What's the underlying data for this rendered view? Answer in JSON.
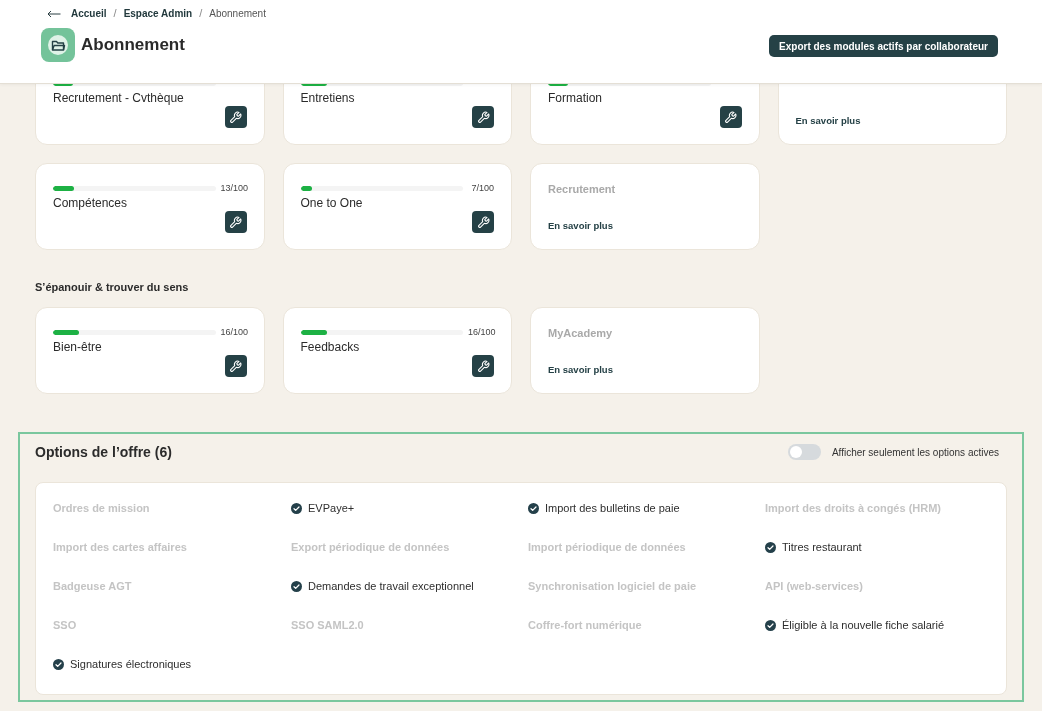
{
  "breadcrumb": {
    "separator": "/",
    "items": [
      {
        "label": "Accueil",
        "current": false
      },
      {
        "label": "Espace Admin",
        "current": false
      },
      {
        "label": "Abonnement",
        "current": true
      }
    ]
  },
  "page": {
    "title": "Abonnement",
    "export_button": "Export des modules actifs par collaborateur"
  },
  "sections": [
    {
      "modules": [
        {
          "kind": "subscribed",
          "name": "Recrutement - Cvthèque",
          "level": 0.12
        },
        {
          "kind": "subscribed",
          "name": "Entretiens",
          "level": 0.16
        },
        {
          "kind": "subscribed",
          "name": "Formation",
          "level": 0.12
        },
        {
          "kind": "unsubscribed",
          "link": "En savoir plus"
        },
        {
          "kind": "subscribed",
          "name": "Compétences",
          "level": 0.13,
          "count": "13/100"
        },
        {
          "kind": "subscribed",
          "name": "One to One",
          "level": 0.07,
          "count": "7/100"
        },
        {
          "kind": "unsubscribed",
          "name": "Recrutement",
          "link": "En savoir plus"
        }
      ]
    },
    {
      "title": "S’épanouir & trouver du sens",
      "modules": [
        {
          "kind": "subscribed",
          "name": "Bien-être",
          "level": 0.16,
          "count": "16/100"
        },
        {
          "kind": "subscribed",
          "name": "Feedbacks",
          "level": 0.16,
          "count": "16/100"
        },
        {
          "kind": "unsubscribed",
          "name": "MyAcademy",
          "link": "En savoir plus"
        }
      ]
    }
  ],
  "options": {
    "title": "Options de l’offre (6)",
    "toggle": {
      "label": "Afficher seulement les options actives",
      "on": false
    },
    "items": [
      {
        "label": "Ordres de mission",
        "active": false
      },
      {
        "label": "EVPaye+",
        "active": true
      },
      {
        "label": "Import des bulletins de paie",
        "active": true
      },
      {
        "label": "Import des droits à congés (HRM)",
        "active": false
      },
      {
        "label": "Import des cartes affaires",
        "active": false
      },
      {
        "label": "Export périodique de données",
        "active": false
      },
      {
        "label": "Import périodique de données",
        "active": false
      },
      {
        "label": "Titres restaurant",
        "active": true
      },
      {
        "label": "Badgeuse AGT",
        "active": false
      },
      {
        "label": "Demandes de travail exceptionnel",
        "active": true
      },
      {
        "label": "Synchronisation logiciel de paie",
        "active": false
      },
      {
        "label": "API (web-services)",
        "active": false
      },
      {
        "label": "SSO",
        "active": false
      },
      {
        "label": "SSO SAML2.0",
        "active": false
      },
      {
        "label": "Coffre-fort numérique",
        "active": false
      },
      {
        "label": "Éligible à la nouvelle fiche salarié",
        "active": true
      },
      {
        "label": "Signatures électroniques",
        "active": true
      }
    ]
  }
}
